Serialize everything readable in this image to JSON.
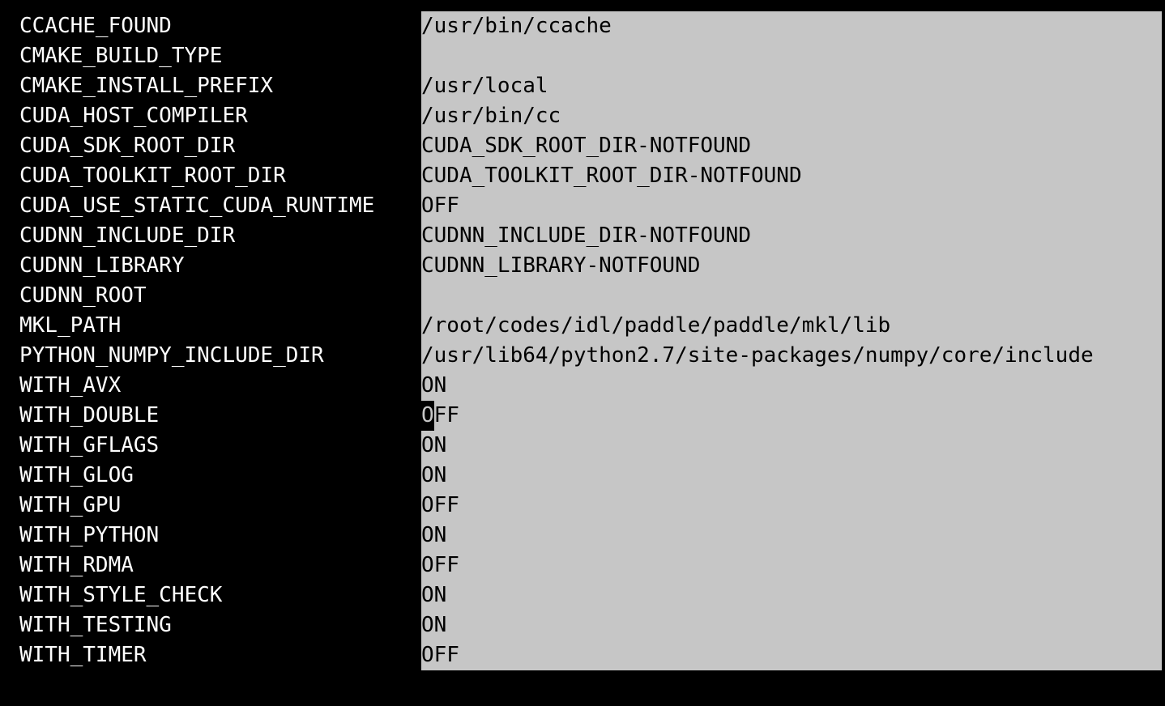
{
  "entries": [
    {
      "key": "CCACHE_FOUND",
      "value": "/usr/bin/ccache"
    },
    {
      "key": "CMAKE_BUILD_TYPE",
      "value": ""
    },
    {
      "key": "CMAKE_INSTALL_PREFIX",
      "value": "/usr/local"
    },
    {
      "key": "CUDA_HOST_COMPILER",
      "value": "/usr/bin/cc"
    },
    {
      "key": "CUDA_SDK_ROOT_DIR",
      "value": "CUDA_SDK_ROOT_DIR-NOTFOUND"
    },
    {
      "key": "CUDA_TOOLKIT_ROOT_DIR",
      "value": "CUDA_TOOLKIT_ROOT_DIR-NOTFOUND"
    },
    {
      "key": "CUDA_USE_STATIC_CUDA_RUNTIME",
      "value": "OFF"
    },
    {
      "key": "CUDNN_INCLUDE_DIR",
      "value": "CUDNN_INCLUDE_DIR-NOTFOUND"
    },
    {
      "key": "CUDNN_LIBRARY",
      "value": "CUDNN_LIBRARY-NOTFOUND"
    },
    {
      "key": "CUDNN_ROOT",
      "value": ""
    },
    {
      "key": "MKL_PATH",
      "value": "/root/codes/idl/paddle/paddle/mkl/lib"
    },
    {
      "key": "PYTHON_NUMPY_INCLUDE_DIR",
      "value": "/usr/lib64/python2.7/site-packages/numpy/core/include"
    },
    {
      "key": "WITH_AVX",
      "value": "ON"
    },
    {
      "key": "WITH_DOUBLE",
      "value": "OFF",
      "cursor": true
    },
    {
      "key": "WITH_GFLAGS",
      "value": "ON"
    },
    {
      "key": "WITH_GLOG",
      "value": "ON"
    },
    {
      "key": "WITH_GPU",
      "value": "OFF"
    },
    {
      "key": "WITH_PYTHON",
      "value": "ON"
    },
    {
      "key": "WITH_RDMA",
      "value": "OFF"
    },
    {
      "key": "WITH_STYLE_CHECK",
      "value": "ON"
    },
    {
      "key": "WITH_TESTING",
      "value": "ON"
    },
    {
      "key": "WITH_TIMER",
      "value": "OFF"
    }
  ]
}
